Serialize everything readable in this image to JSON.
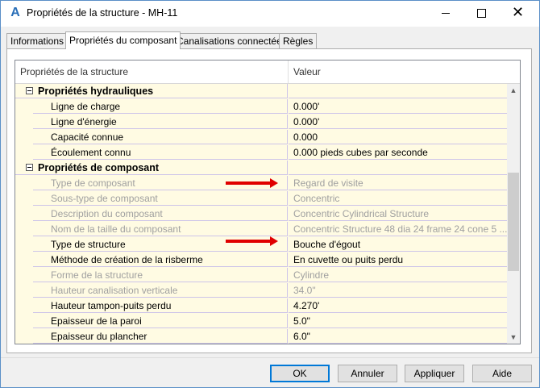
{
  "window": {
    "title": "Propriétés de la structure - MH-11",
    "app_icon": "A",
    "controls": {
      "minimize_icon": "minimize-icon",
      "maximize_icon": "maximize-icon",
      "close_icon": "close-icon",
      "close_glyph": "✕"
    }
  },
  "tabs": [
    {
      "label": "Informations",
      "active": false
    },
    {
      "label": "Propriétés du composant",
      "active": true
    },
    {
      "label": "Canalisations connectées",
      "active": false
    },
    {
      "label": "Règles",
      "active": false
    }
  ],
  "grid": {
    "headers": {
      "property": "Propriétés de la structure",
      "value": "Valeur"
    },
    "categories": [
      {
        "label": "Propriétés hydrauliques",
        "rows": [
          {
            "name": "Ligne de charge",
            "value": "0.000'",
            "enabled": true
          },
          {
            "name": "Ligne d'énergie",
            "value": "0.000'",
            "enabled": true
          },
          {
            "name": "Capacité connue",
            "value": "0.000",
            "enabled": true
          },
          {
            "name": "Écoulement connu",
            "value": "0.000 pieds cubes par seconde",
            "enabled": true
          }
        ]
      },
      {
        "label": "Propriétés de composant",
        "rows": [
          {
            "name": "Type de composant",
            "value": "Regard de visite",
            "enabled": false
          },
          {
            "name": "Sous-type de composant",
            "value": "Concentric",
            "enabled": false
          },
          {
            "name": "Description du composant",
            "value": "Concentric Cylindrical Structure",
            "enabled": false
          },
          {
            "name": "Nom de la taille du composant",
            "value": "Concentric Structure 48 dia 24 frame 24 cone 5 ...",
            "enabled": false
          },
          {
            "name": "Type de structure",
            "value": "Bouche d'égout",
            "enabled": true
          },
          {
            "name": "Méthode de création de la risberme",
            "value": "En cuvette ou puits perdu",
            "enabled": true
          },
          {
            "name": "Forme de la structure",
            "value": "Cylindre",
            "enabled": false
          },
          {
            "name": "Hauteur canalisation verticale",
            "value": "34.0\"",
            "enabled": false
          },
          {
            "name": "Hauteur tampon-puits perdu",
            "value": "4.270'",
            "enabled": true
          },
          {
            "name": "Epaisseur de la paroi",
            "value": "5.0\"",
            "enabled": true
          },
          {
            "name": "Epaisseur du plancher",
            "value": "6.0\"",
            "enabled": true
          }
        ]
      }
    ],
    "scrollbar": {
      "up_glyph": "▲",
      "down_glyph": "▼"
    }
  },
  "annotations": {
    "arrow_color": "#e00000"
  },
  "buttons": {
    "ok": "OK",
    "cancel": "Annuler",
    "apply": "Appliquer",
    "help": "Aide"
  }
}
